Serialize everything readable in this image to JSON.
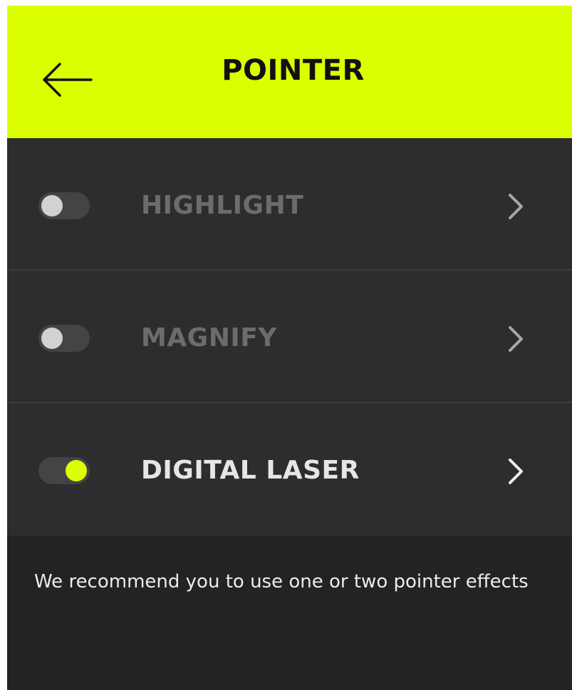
{
  "header": {
    "title": "POINTER",
    "back_icon": "arrow-left-icon",
    "background_color": "#dcff00"
  },
  "pointer_effects": [
    {
      "label": "HIGHLIGHT",
      "enabled": false,
      "chevron_icon": "chevron-right-icon"
    },
    {
      "label": "MAGNIFY",
      "enabled": false,
      "chevron_icon": "chevron-right-icon"
    },
    {
      "label": "DIGITAL LASER",
      "enabled": true,
      "chevron_icon": "chevron-right-icon"
    }
  ],
  "footer": {
    "recommendation": "We recommend you to use one or two pointer effects"
  },
  "colors": {
    "accent": "#dcff00",
    "list_background": "#2d2d2f",
    "footer_background": "#222325",
    "label_disabled": "#6c6c6e",
    "label_enabled": "#e6e6e8"
  }
}
